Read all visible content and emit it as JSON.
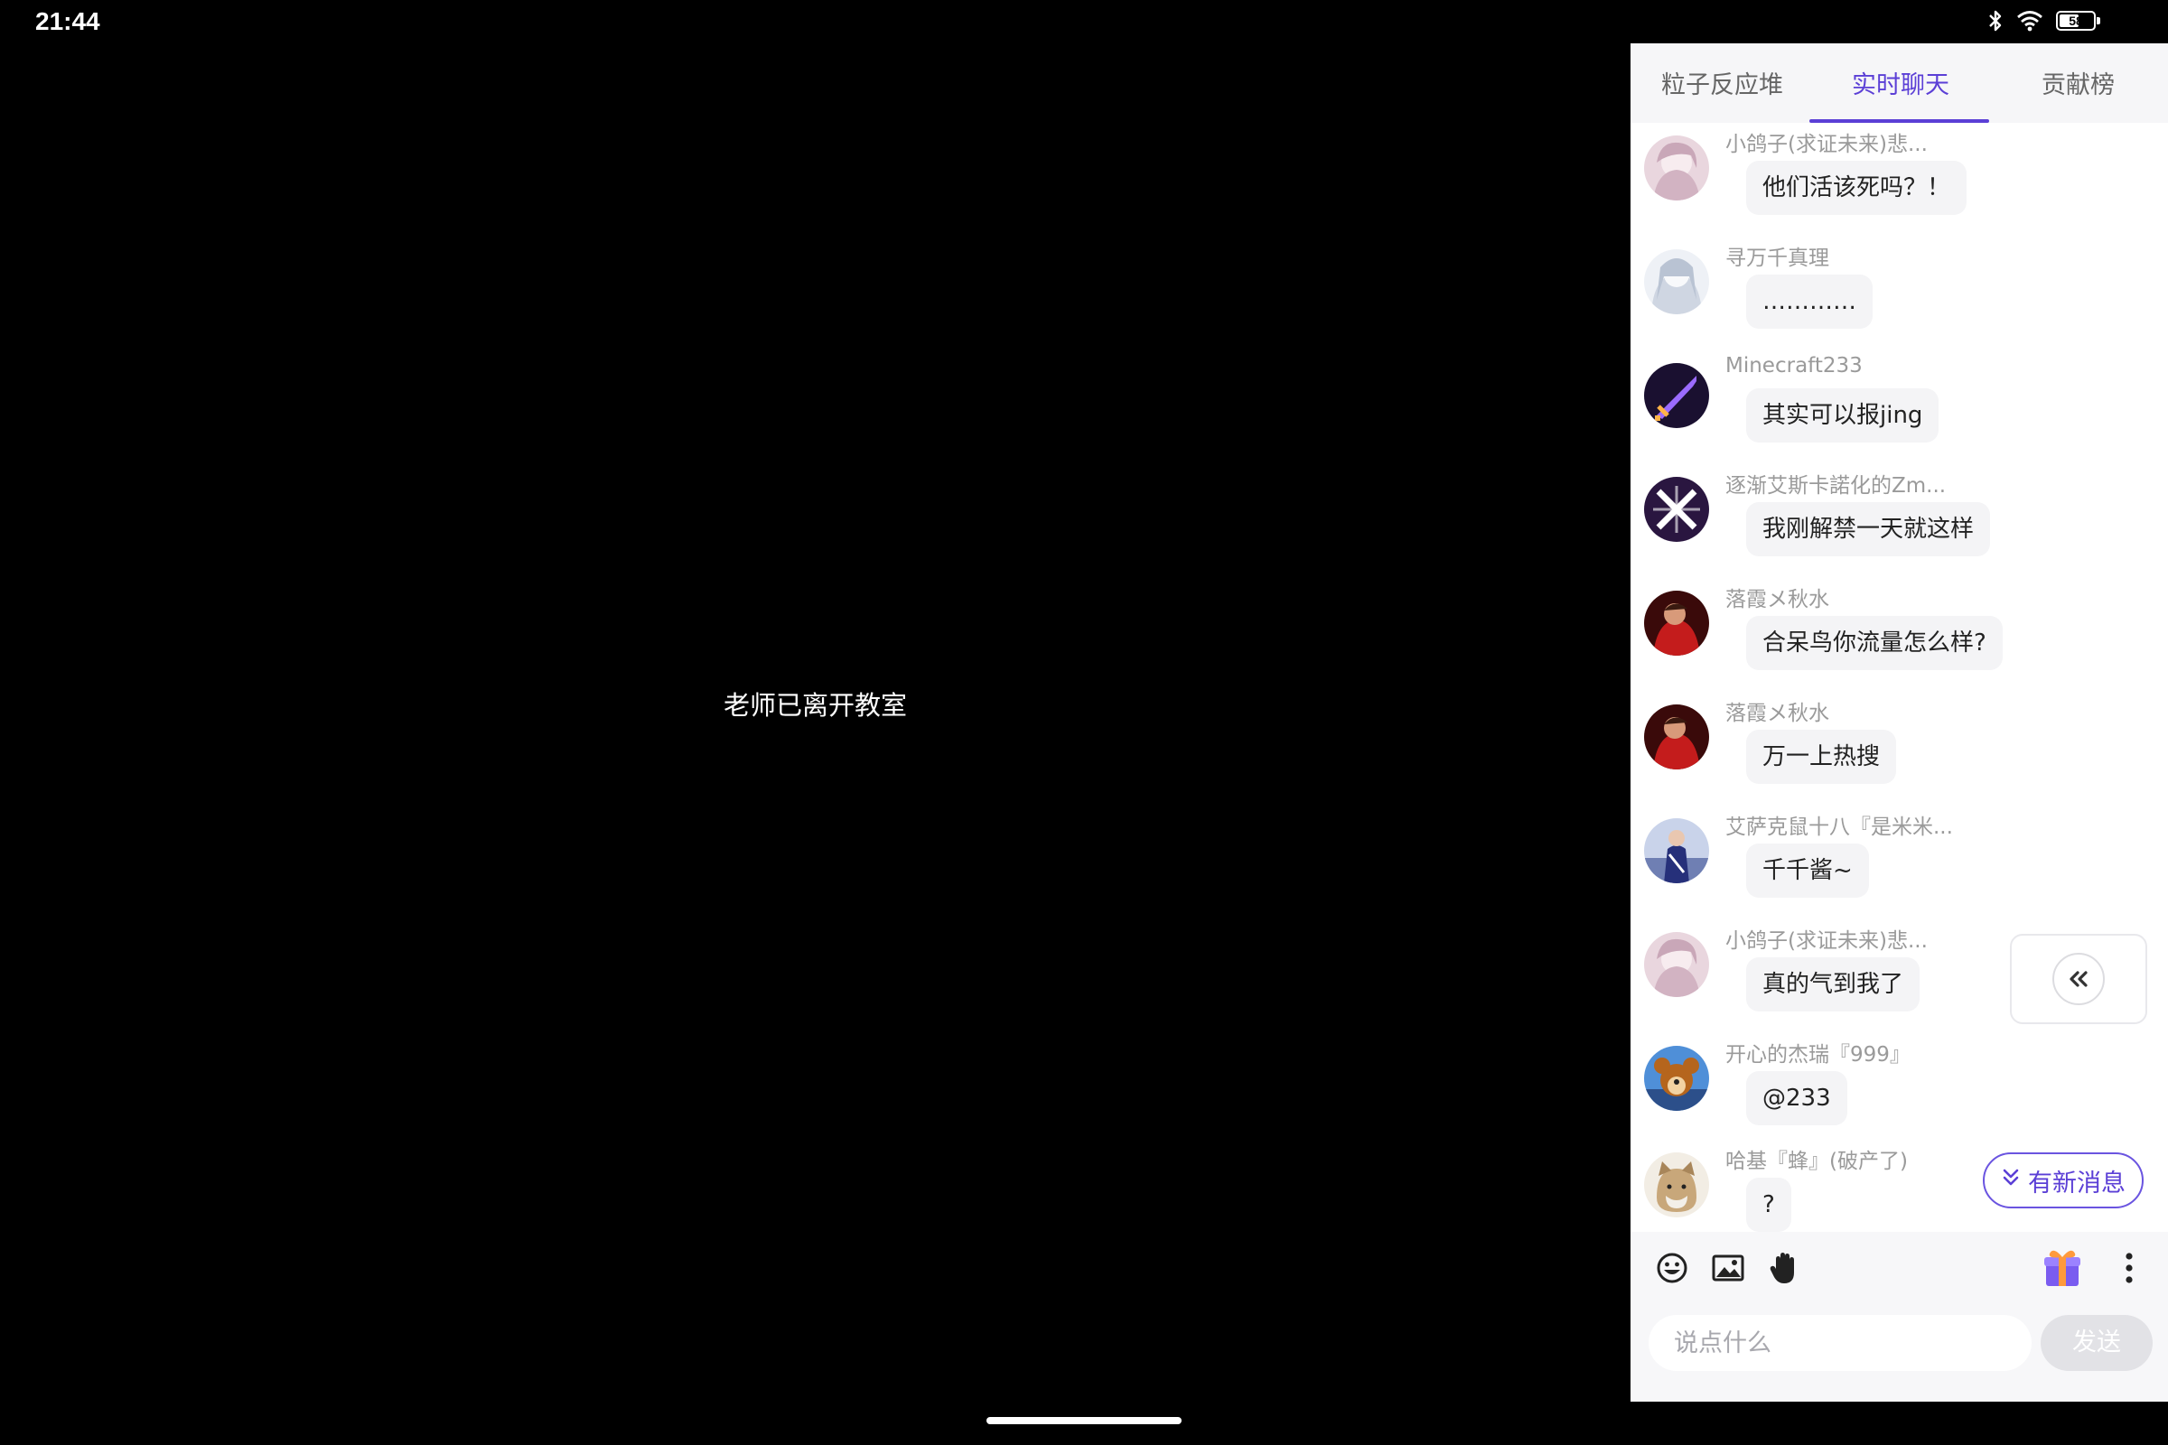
{
  "status": {
    "time": "21:44",
    "battery_level": "58",
    "battery_fraction": 0.58
  },
  "video": {
    "message": "老师已离开教室"
  },
  "tabs": [
    {
      "label": "粒子反应堆",
      "active": false
    },
    {
      "label": "实时聊天",
      "active": true
    },
    {
      "label": "贡献榜",
      "active": false
    }
  ],
  "messages": [
    {
      "user": "小鸽子(求证未来)悲...",
      "text": "他们活该死吗？！",
      "avatar": "anime-girl-pink"
    },
    {
      "user": "寻万千真理",
      "text": "…………",
      "avatar": "anime-girl-white"
    },
    {
      "user": "Minecraft233",
      "text": "其实可以报jing",
      "avatar": "pixel-sword"
    },
    {
      "user": "逐渐艾斯卡諾化的Zm...",
      "text": "我刚解禁一天就这样",
      "avatar": "x-logo"
    },
    {
      "user": "落霞メ秋水",
      "text": "合呆鸟你流量怎么样?",
      "avatar": "red-figure"
    },
    {
      "user": "落霞メ秋水",
      "text": "万一上热搜",
      "avatar": "red-figure"
    },
    {
      "user": "艾萨克鼠十八『是米米...",
      "text": "千千酱~",
      "avatar": "performer"
    },
    {
      "user": "小鸽子(求证未来)悲...",
      "text": "真的气到我了",
      "avatar": "anime-girl-pink"
    },
    {
      "user": "开心的杰瑞『999』",
      "text": "@233",
      "avatar": "cartoon-mouse"
    },
    {
      "user": "哈基『蜂』(破产了)",
      "text": "?",
      "avatar": "cat"
    }
  ],
  "new_message_button": "有新消息",
  "toolbar": {
    "icons": [
      "emoji-icon",
      "image-icon",
      "raise-hand-icon",
      "gift-icon",
      "more-icon"
    ],
    "input_placeholder": "说点什么",
    "send_label": "发送"
  },
  "colors": {
    "accent": "#5b3fd6",
    "panel_bg": "#ffffff",
    "video_bg": "#000000"
  }
}
